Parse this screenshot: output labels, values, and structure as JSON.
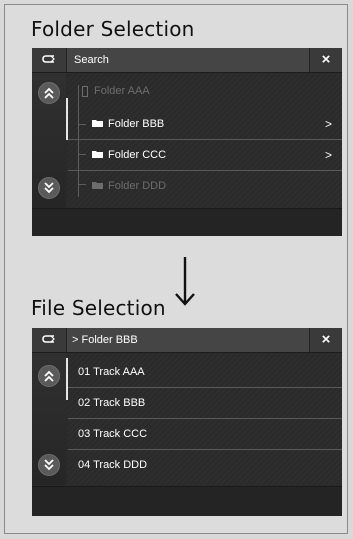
{
  "headings": {
    "folder_selection": "Folder Selection",
    "file_selection": "File Selection"
  },
  "arrow_glyph": "⟶",
  "folder_screen": {
    "title": "Search",
    "back_icon": "back-arrow-icon",
    "close_symbol": "×",
    "items": [
      {
        "label": "Folder AAA",
        "state": "dim"
      },
      {
        "label": "Folder BBB",
        "chevron": ">"
      },
      {
        "label": "Folder CCC",
        "chevron": ">"
      },
      {
        "label": "Folder DDD",
        "state": "dim"
      }
    ]
  },
  "file_screen": {
    "title": "> Folder BBB",
    "close_symbol": "×",
    "items": [
      {
        "label": "01 Track AAA"
      },
      {
        "label": "02 Track BBB"
      },
      {
        "label": "03 Track CCC"
      },
      {
        "label": "04 Track DDD"
      }
    ]
  },
  "colors": {
    "background": "#dcdcdc",
    "screen": "#2b2b2b",
    "titlebar": "#454545",
    "dim_text": "#6d6d6d"
  }
}
